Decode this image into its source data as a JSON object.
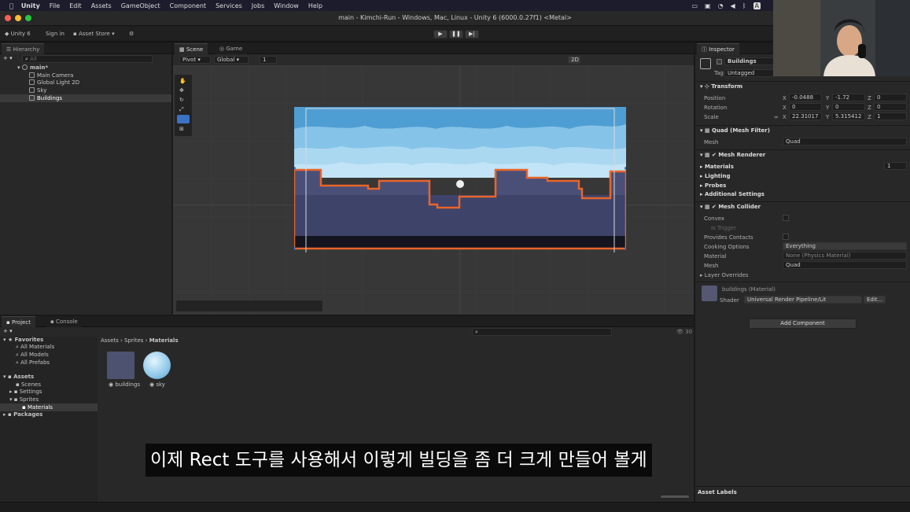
{
  "menubar": {
    "app": "Unity",
    "items": [
      "File",
      "Edit",
      "Assets",
      "GameObject",
      "Component",
      "Services",
      "Jobs",
      "Window",
      "Help"
    ]
  },
  "window_title": "main - Kimchi-Run - Windows, Mac, Linux - Unity 6 (6000.0.27f1) <Metal>",
  "toolbar": {
    "account": "Unity 6",
    "signin": "Sign in",
    "asset_store": "Asset Store"
  },
  "hierarchy": {
    "tab": "Hierarchy",
    "search_placeholder": "All",
    "scene": "main*",
    "items": [
      "Main Camera",
      "Global Light 2D",
      "Sky",
      "Buildings"
    ]
  },
  "scene": {
    "tabs": [
      "Scene",
      "Game"
    ],
    "pivot": "Pivot",
    "global": "Global",
    "snap": "1",
    "mode_2d": "2D"
  },
  "inspector": {
    "tab": "Inspector",
    "object_name": "Buildings",
    "tag_label": "Tag",
    "tag_value": "Untagged",
    "transform": {
      "title": "Transform",
      "position_label": "Position",
      "position": {
        "x": "-0.0488",
        "y": "-1.72",
        "z": "0"
      },
      "rotation_label": "Rotation",
      "rotation": {
        "x": "0",
        "y": "0",
        "z": "0"
      },
      "scale_label": "Scale",
      "scale": {
        "x": "22.31017",
        "y": "5.315412",
        "z": "1"
      }
    },
    "mesh_filter": {
      "title": "Quad (Mesh Filter)",
      "mesh_label": "Mesh",
      "mesh": "Quad"
    },
    "mesh_renderer": {
      "title": "Mesh Renderer",
      "materials": "Materials",
      "materials_count": "1",
      "lighting": "Lighting",
      "probes": "Probes",
      "additional": "Additional Settings"
    },
    "mesh_collider": {
      "title": "Mesh Collider",
      "convex": "Convex",
      "is_trigger": "Is Trigger",
      "provides_contacts": "Provides Contacts",
      "cooking_label": "Cooking Options",
      "cooking_value": "Everything",
      "material_label": "Material",
      "material_value": "None (Physics Material)",
      "mesh_label": "Mesh",
      "mesh_value": "Quad",
      "layer_overrides": "Layer Overrides"
    },
    "material": {
      "title": "buildings (Material)",
      "shader_label": "Shader",
      "shader_value": "Universal Render Pipeline/Lit",
      "edit": "Edit..."
    },
    "add_component": "Add Component",
    "asset_labels": "Asset Labels"
  },
  "project": {
    "tabs": [
      "Project",
      "Console"
    ],
    "favorites": "Favorites",
    "fav_items": [
      "All Materials",
      "All Models",
      "All Prefabs"
    ],
    "assets": "Assets",
    "asset_folders": [
      "Scenes",
      "Settings",
      "Sprites"
    ],
    "sprites_child": "Materials",
    "packages": "Packages",
    "breadcrumb": [
      "Assets",
      "Sprites",
      "Materials"
    ],
    "files": [
      "buildings",
      "sky"
    ],
    "count": "30"
  },
  "subtitle": "이제 Rect 도구를 사용해서 이렇게 빌딩을 좀 더 크게 만들어 볼게",
  "colors": {
    "accent": "#3a72c4",
    "selection_orange": "#e8652a",
    "sky_blue": "#8fc8ea",
    "building": "#4a4f78"
  }
}
